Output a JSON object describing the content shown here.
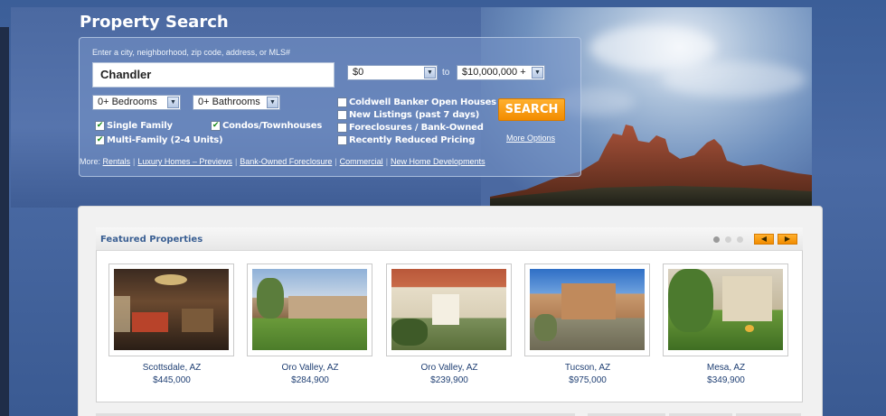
{
  "page": {
    "title": "Property Search"
  },
  "search": {
    "hint": "Enter a city, neighborhood, zip code, address, or MLS#",
    "city_value": "Chandler",
    "min_price": "$0",
    "to_label": "to",
    "max_price": "$10,000,000 +",
    "bedrooms": "0+ Bedrooms",
    "bathrooms": "0+ Bathrooms",
    "search_button": "SEARCH",
    "more_options": "More Options"
  },
  "property_types": [
    {
      "label": "Single Family",
      "checked": true
    },
    {
      "label": "Condos/Townhouses",
      "checked": true
    },
    {
      "label": "Multi-Family (2-4 Units)",
      "checked": true
    }
  ],
  "filters": [
    {
      "label": "Coldwell Banker Open Houses",
      "checked": false
    },
    {
      "label": "New Listings (past 7 days)",
      "checked": false
    },
    {
      "label": "Foreclosures / Bank-Owned",
      "checked": false
    },
    {
      "label": "Recently Reduced Pricing",
      "checked": false
    }
  ],
  "more": {
    "label": "More:",
    "links": [
      "Rentals",
      "Luxury Homes – Previews",
      "Bank-Owned Foreclosure",
      "Commercial",
      "New Home Developments"
    ]
  },
  "featured": {
    "title": "Featured Properties",
    "properties": [
      {
        "location": "Scottsdale, AZ",
        "price": "$445,000"
      },
      {
        "location": "Oro Valley, AZ",
        "price": "$284,900"
      },
      {
        "location": "Oro Valley, AZ",
        "price": "$239,900"
      },
      {
        "location": "Tucson, AZ",
        "price": "$975,000"
      },
      {
        "location": "Mesa, AZ",
        "price": "$349,900"
      }
    ]
  },
  "colors": {
    "accent_orange": "#f28c00",
    "link_blue": "#1f3f73",
    "hero_blue": "#4b69a1"
  }
}
